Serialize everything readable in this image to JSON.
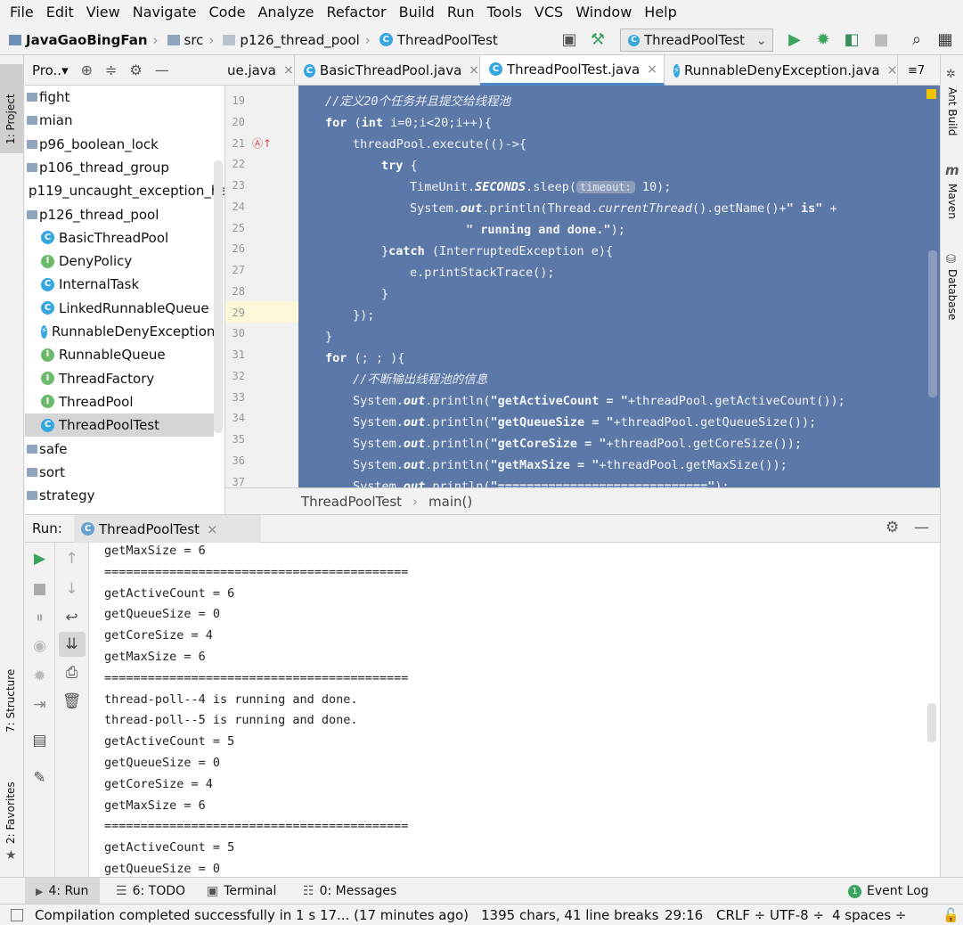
{
  "menu": [
    "File",
    "Edit",
    "View",
    "Navigate",
    "Code",
    "Analyze",
    "Refactor",
    "Build",
    "Run",
    "Tools",
    "VCS",
    "Window",
    "Help"
  ],
  "nav": {
    "crumbs": [
      "JavaGaoBingFan",
      "src",
      "p126_thread_pool",
      "ThreadPoolTest"
    ],
    "run_config": "ThreadPoolTest"
  },
  "left_stripe": {
    "project": "1: Project",
    "structure": "7: Structure",
    "favorites": "2: Favorites"
  },
  "right_stripe": {
    "ant": "Ant Build",
    "maven": "Maven",
    "database": "Database"
  },
  "project_panel": {
    "title": "Pro..▾",
    "items": [
      {
        "label": "fight",
        "kind": "folder"
      },
      {
        "label": "mian",
        "kind": "folder"
      },
      {
        "label": "p96_boolean_lock",
        "kind": "folder"
      },
      {
        "label": "p106_thread_group",
        "kind": "folder"
      },
      {
        "label": "p119_uncaught_exception_ha",
        "kind": "folder"
      },
      {
        "label": "p126_thread_pool",
        "kind": "folder"
      },
      {
        "label": "BasicThreadPool",
        "kind": "class"
      },
      {
        "label": "DenyPolicy",
        "kind": "interface"
      },
      {
        "label": "InternalTask",
        "kind": "class"
      },
      {
        "label": "LinkedRunnableQueue",
        "kind": "class"
      },
      {
        "label": "RunnableDenyException",
        "kind": "exception"
      },
      {
        "label": "RunnableQueue",
        "kind": "interface"
      },
      {
        "label": "ThreadFactory",
        "kind": "interface"
      },
      {
        "label": "ThreadPool",
        "kind": "interface"
      },
      {
        "label": "ThreadPoolTest",
        "kind": "class"
      },
      {
        "label": "safe",
        "kind": "folder"
      },
      {
        "label": "sort",
        "kind": "folder"
      },
      {
        "label": "strategy",
        "kind": "folder"
      }
    ]
  },
  "tabs": [
    {
      "label": "ue.java"
    },
    {
      "label": "BasicThreadPool.java"
    },
    {
      "label": "ThreadPoolTest.java"
    },
    {
      "label": "RunnableDenyException.java"
    }
  ],
  "tab_overflow": "≡7",
  "code_lines": [
    {
      "n": "19"
    },
    {
      "n": "20"
    },
    {
      "n": "21"
    },
    {
      "n": "22"
    },
    {
      "n": "23"
    },
    {
      "n": "24"
    },
    {
      "n": "25"
    },
    {
      "n": "26"
    },
    {
      "n": "27"
    },
    {
      "n": "28"
    },
    {
      "n": "29"
    },
    {
      "n": "30"
    },
    {
      "n": "31"
    },
    {
      "n": "32"
    },
    {
      "n": "33"
    },
    {
      "n": "34"
    },
    {
      "n": "35"
    },
    {
      "n": "36"
    },
    {
      "n": "37"
    }
  ],
  "code": {
    "l19": "//定义20个任务并且提交给线程池",
    "l20a": "for",
    "l20b": " (",
    "l20c": "int",
    "l20d": " i=0;i<20;i++){",
    "l21": "threadPool.execute(()->{",
    "l22": "try",
    "l22b": " {",
    "l23a": "TimeUnit.",
    "l23b": "SECONDS",
    "l23c": ".sleep(",
    "l23hint": "timeout:",
    "l23d": " 10);",
    "l24a": "System.",
    "l24b": "out",
    "l24c": ".println(Thread.",
    "l24d": "currentThread",
    "l24e": "().getName()+",
    "l24f": "\" is\"",
    "l24g": " +",
    "l25": "\" running and done.\"",
    "l25b": ");",
    "l26a": "}",
    "l26b": "catch",
    "l26c": " (InterruptedException e){",
    "l27": "e.printStackTrace();",
    "l28": "}",
    "l29": "});",
    "l30": "}",
    "l31a": "for",
    "l31b": " (; ; ){",
    "l32": "//不断输出线程池的信息",
    "l33a": "System.",
    "l33b": "out",
    "l33c": ".println(",
    "l33d": "\"getActiveCount = \"",
    "l33e": "+threadPool.getActiveCount());",
    "l34a": "System.",
    "l34b": "out",
    "l34c": ".println(",
    "l34d": "\"getQueueSize = \"",
    "l34e": "+threadPool.getQueueSize());",
    "l35a": "System.",
    "l35b": "out",
    "l35c": ".println(",
    "l35d": "\"getCoreSize = \"",
    "l35e": "+threadPool.getCoreSize());",
    "l36a": "System.",
    "l36b": "out",
    "l36c": ".println(",
    "l36d": "\"getMaxSize = \"",
    "l36e": "+threadPool.getMaxSize());",
    "l37a": "System.",
    "l37b": "out",
    "l37c": ".println(",
    "l37d": "\"=============================\"",
    "l37e": ");"
  },
  "editor_breadcrumb": {
    "a": "ThreadPoolTest",
    "b": "main()"
  },
  "run_panel": {
    "label": "Run:",
    "tab": "ThreadPoolTest"
  },
  "console_lines": [
    "getMaxSize = 6",
    "==========================================",
    "getActiveCount = 6",
    "getQueueSize = 0",
    "getCoreSize = 4",
    "getMaxSize = 6",
    "==========================================",
    "thread-poll--4 is running and done.",
    "thread-poll--5 is running and done.",
    "getActiveCount = 5",
    "getQueueSize = 0",
    "getCoreSize = 4",
    "getMaxSize = 6",
    "==========================================",
    "getActiveCount = 5",
    "getQueueSize = 0"
  ],
  "bottom_tools": {
    "run": "4: Run",
    "todo": "6: TODO",
    "terminal": "Terminal",
    "messages": "0: Messages",
    "event_log": "Event Log",
    "event_count": "1"
  },
  "status": {
    "message": "Compilation completed successfully in 1 s 17... (17 minutes ago)",
    "chars": "1395 chars, 41 line breaks",
    "position": "29:16",
    "line_sep": "CRLF ÷",
    "encoding": "UTF-8 ÷",
    "indent": "4 spaces ÷"
  },
  "colors": {
    "selection": "#5c78a8",
    "accent": "#4a88c7",
    "run_green": "#3aa35d"
  }
}
